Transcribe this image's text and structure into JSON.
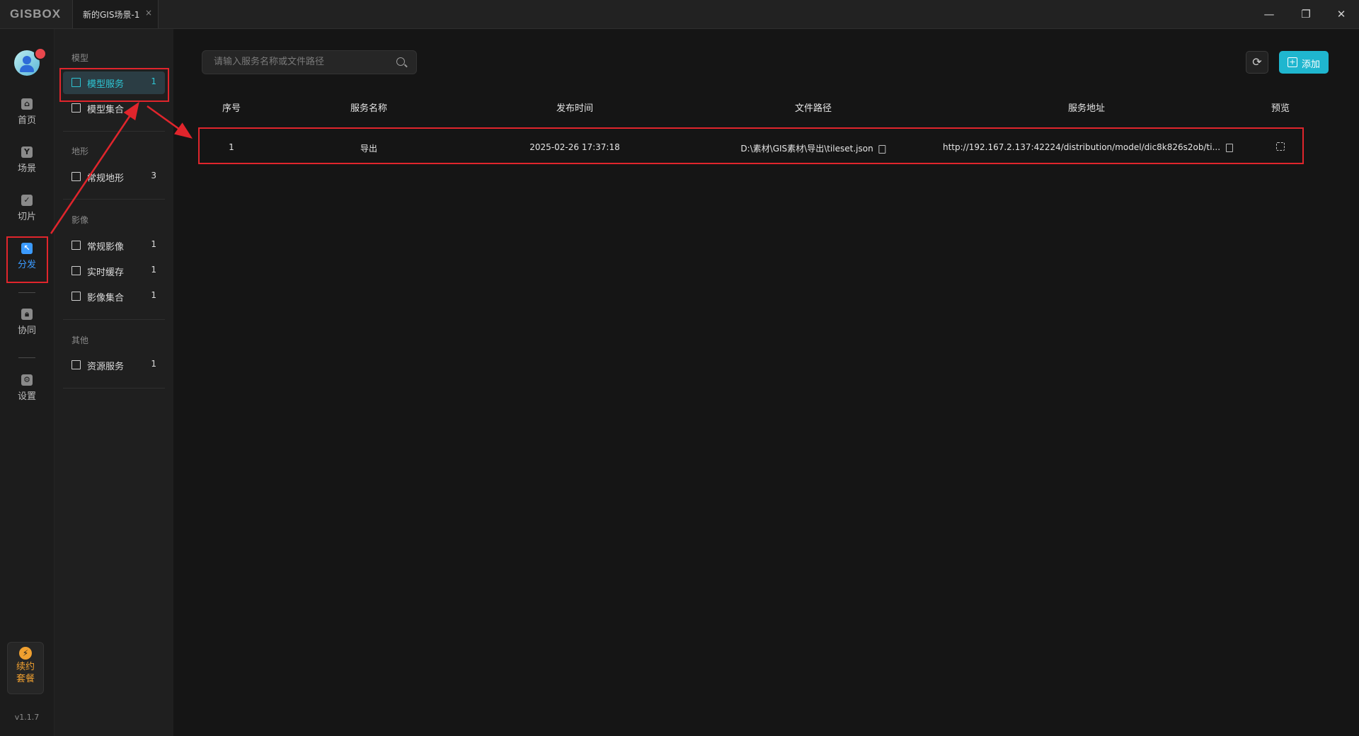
{
  "app": {
    "logo": "GISBOX",
    "version": "v1.1.7"
  },
  "tabs": [
    {
      "label": "新的GIS场景-1",
      "close": "×"
    }
  ],
  "window_controls": {
    "minimize": "—",
    "maximize": "❐",
    "close": "✕"
  },
  "nav": [
    {
      "label": "首页",
      "icon": "home-icon"
    },
    {
      "label": "场景",
      "icon": "scene-icon"
    },
    {
      "label": "切片",
      "icon": "slice-icon"
    },
    {
      "label": "分发",
      "icon": "distribute-icon",
      "active": true
    },
    {
      "label": "协同",
      "icon": "lock-icon"
    },
    {
      "label": "设置",
      "icon": "gear-icon"
    }
  ],
  "renew": {
    "label_line1": "续约",
    "label_line2": "套餐"
  },
  "sidebar": {
    "sections": [
      {
        "title": "模型",
        "items": [
          {
            "label": "模型服务",
            "count": "1",
            "active": true
          },
          {
            "label": "模型集合",
            "count": ""
          }
        ]
      },
      {
        "title": "地形",
        "items": [
          {
            "label": "常规地形",
            "count": "3"
          }
        ]
      },
      {
        "title": "影像",
        "items": [
          {
            "label": "常规影像",
            "count": "1"
          },
          {
            "label": "实时缓存",
            "count": "1"
          },
          {
            "label": "影像集合",
            "count": "1"
          }
        ]
      },
      {
        "title": "其他",
        "items": [
          {
            "label": "资源服务",
            "count": "1"
          }
        ]
      }
    ]
  },
  "toolbar": {
    "search_placeholder": "请输入服务名称或文件路径",
    "add_label": "添加"
  },
  "table": {
    "columns": [
      "序号",
      "服务名称",
      "发布时间",
      "文件路径",
      "服务地址",
      "预览"
    ],
    "rows": [
      {
        "index": "1",
        "name": "导出",
        "time": "2025-02-26 17:37:18",
        "path": "D:\\素材\\GIS素材\\导出\\tileset.json",
        "url": "http://192.167.2.137:42224/distribution/model/dic8k826s2ob/ti..."
      }
    ]
  },
  "colors": {
    "accent": "#2ec5d3",
    "nav_active": "#3b9bff",
    "highlight": "#e0252c",
    "add_button": "#1fb6cf"
  }
}
